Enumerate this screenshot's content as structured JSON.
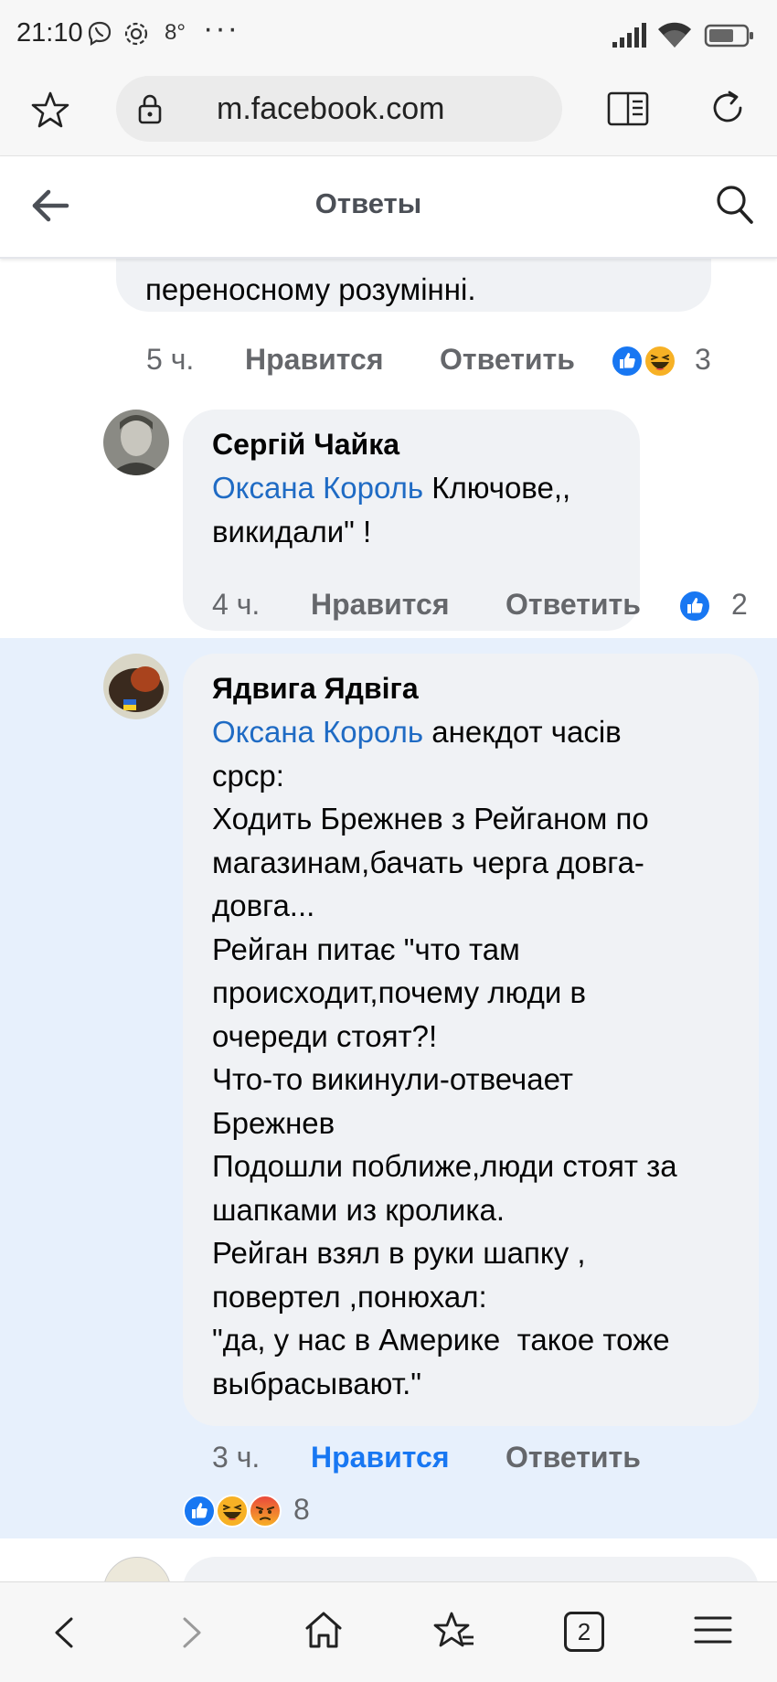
{
  "status_bar": {
    "time": "21:10",
    "temperature": "8°",
    "more": "···"
  },
  "browser": {
    "url": "m.facebook.com"
  },
  "header": {
    "title": "Ответы"
  },
  "comments": [
    {
      "partial_text": "переносному розумінні.",
      "time": "5 ч.",
      "like_label": "Нравится",
      "reply_label": "Ответить",
      "reactions": [
        "like",
        "haha"
      ],
      "reaction_count": "3"
    },
    {
      "author": "Сергій Чайка",
      "mention": "Оксана Король",
      "text_after_mention_line1": " Ключове,,",
      "text_rest": "викидали\" !",
      "time": "4 ч.",
      "like_label": "Нравится",
      "reply_label": "Ответить",
      "reactions": [
        "like"
      ],
      "reaction_count": "2"
    },
    {
      "author": "Ядвига Ядвіга",
      "mention": "Оксана Король",
      "text_after_mention_line1": " анекдот часів",
      "text_lines": [
        "срср:",
        "Ходить Брежнев з Рейганом по",
        "магазинам,бачать черга довга-",
        "довга...",
        "Рейган питає \"что там",
        "происходит,почему люди в",
        "очереди стоят?!",
        "Что-то викинули-отвечает",
        "Брежнев",
        "Подошли поближе,люди стоят за",
        "шапками из кролика.",
        "Рейган взял в руки шапку ,",
        "повертел ,понюхал:",
        "\"да, у нас в Америке  такое тоже",
        "выбрасывают.\""
      ],
      "time": "3 ч.",
      "like_label": "Нравится",
      "reply_label": "Ответить",
      "reactions": [
        "like",
        "haha",
        "angry"
      ],
      "reaction_count": "8",
      "liked_by_viewer": true
    }
  ],
  "bottom_nav": {
    "tabs_count": "2"
  },
  "colors": {
    "link_blue": "#1f6bc4",
    "highlight_bg": "#e7f0fc",
    "bubble_bg": "#f0f2f5",
    "meta_gray": "#65676b"
  }
}
